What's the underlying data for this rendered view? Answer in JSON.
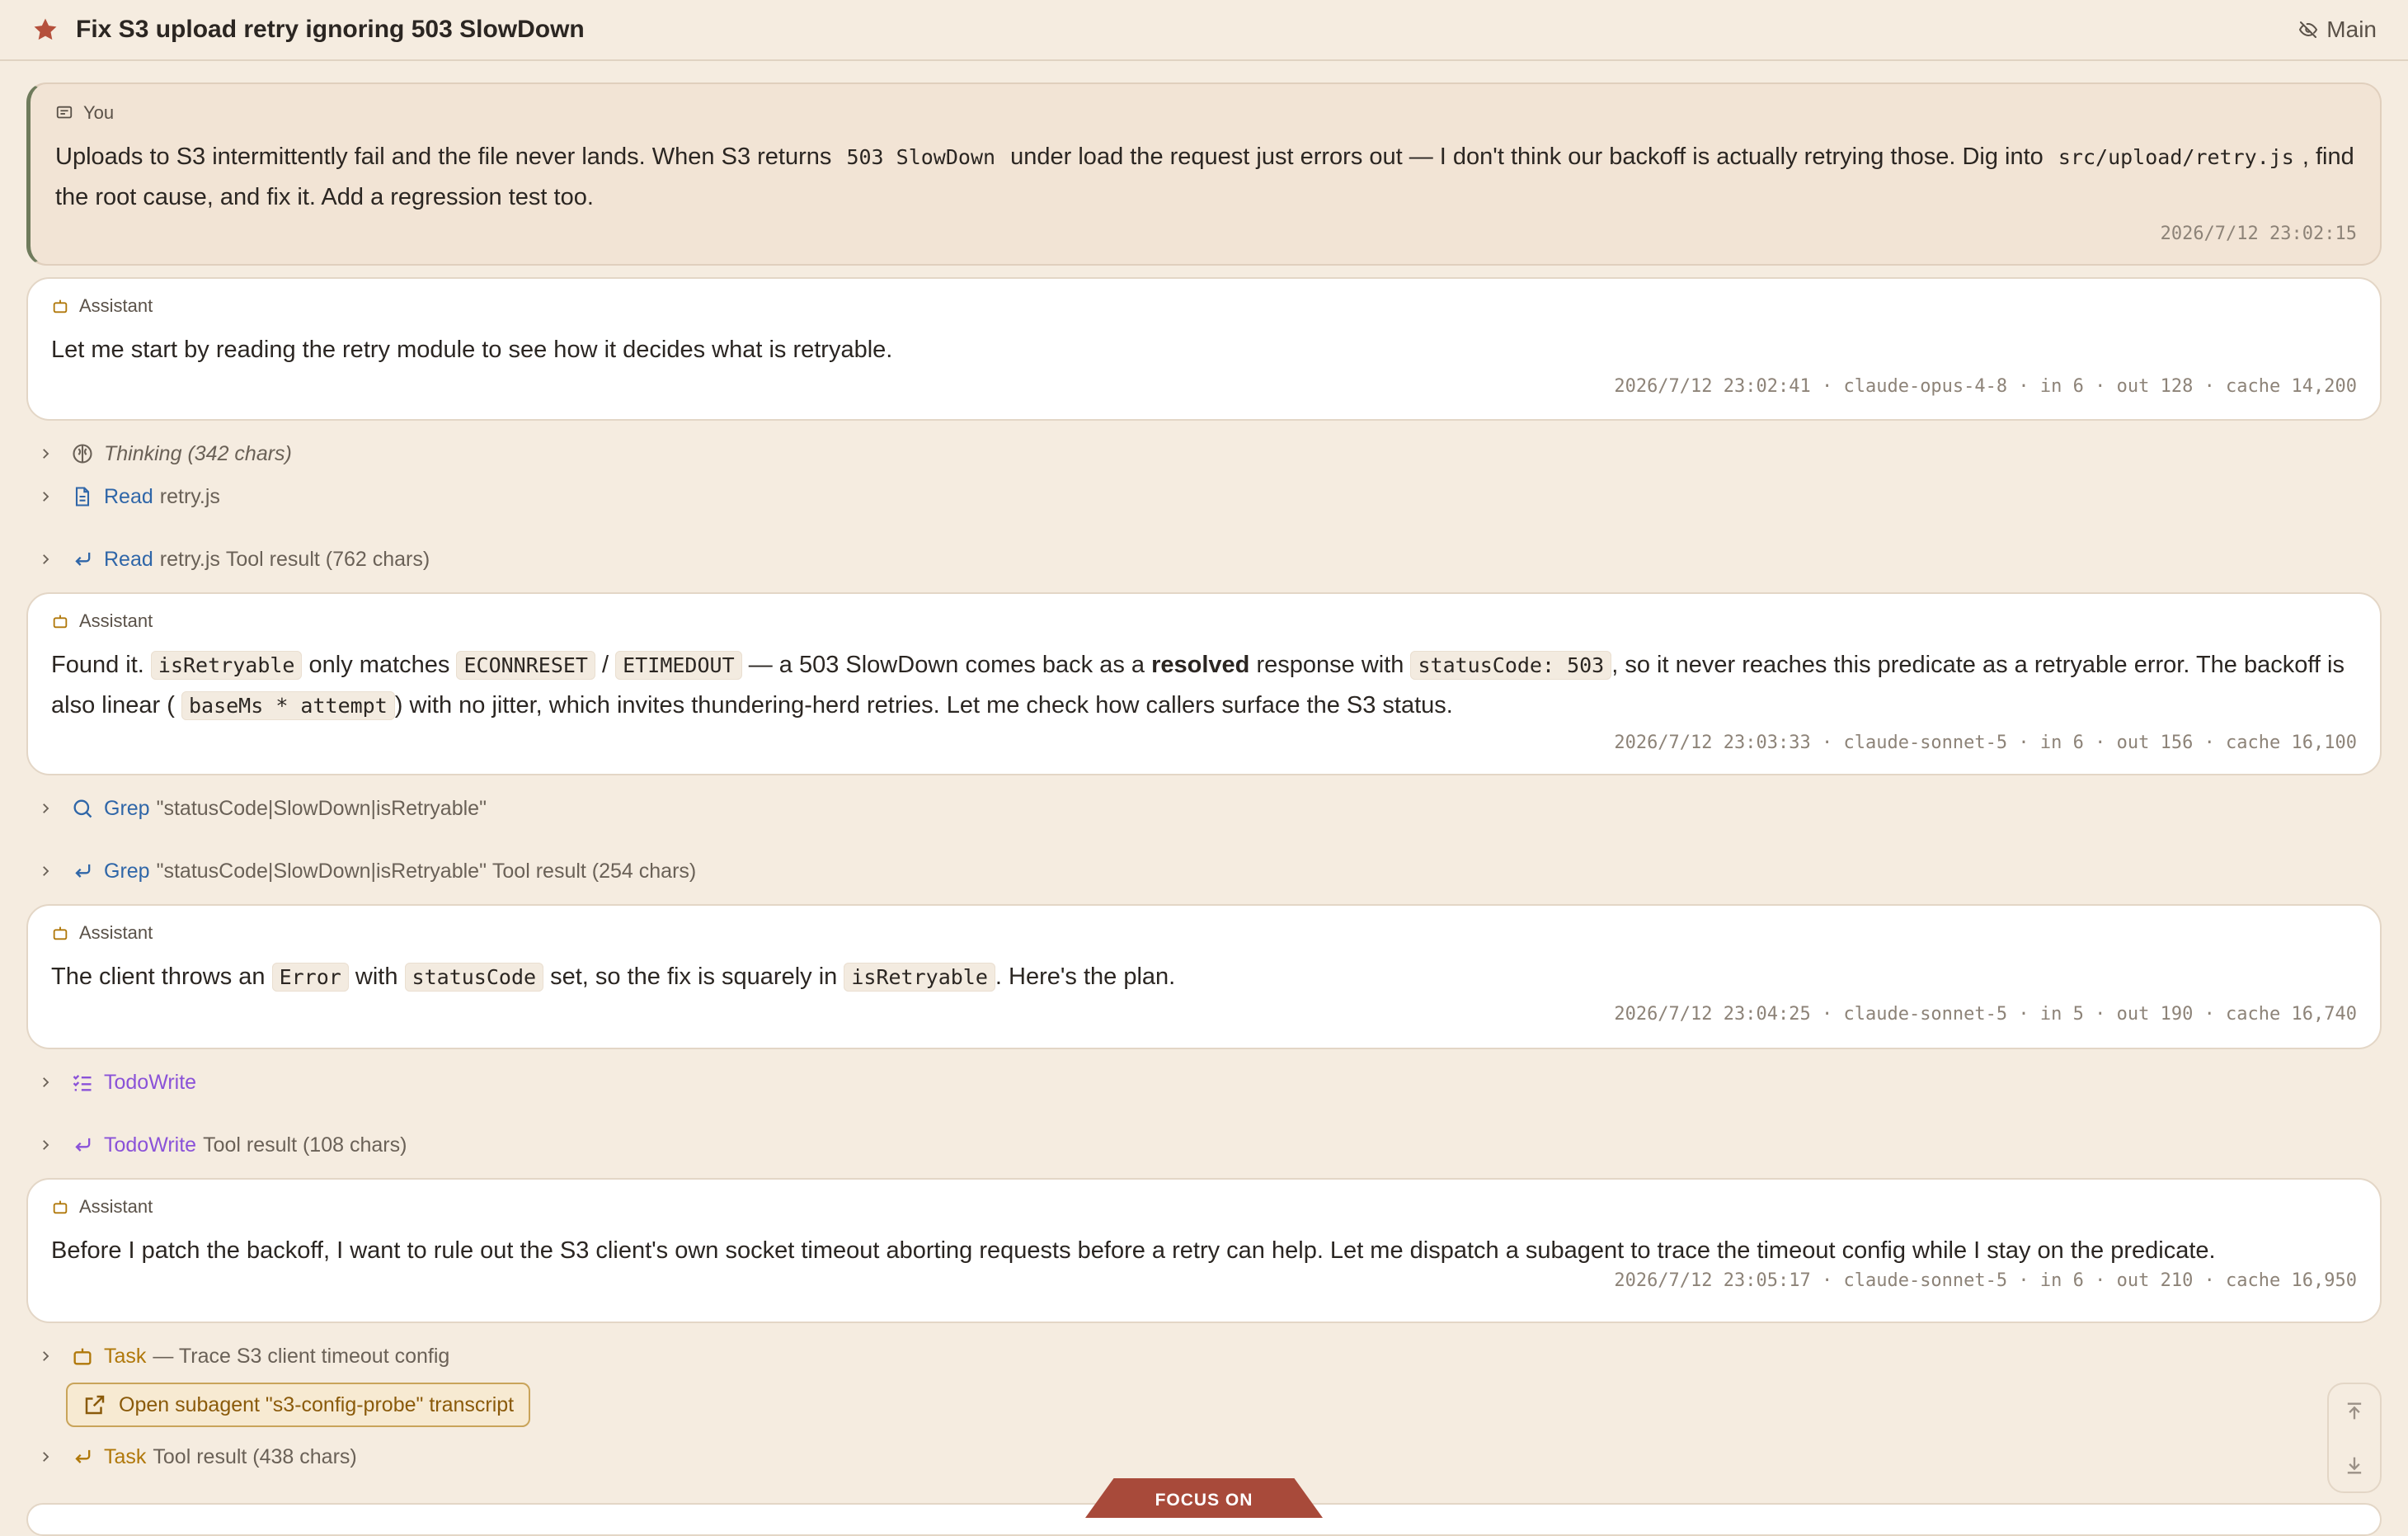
{
  "header": {
    "title": "Fix S3 upload retry ignoring 503 SlowDown",
    "toggle_label": "Main"
  },
  "user_message": {
    "role": "You",
    "p1": "Uploads to S3 intermittently fail and the file never lands. When S3 returns",
    "c1": "503 SlowDown",
    "p2": "under load the request just errors out — I don't think our backoff is actually retrying those. Dig into",
    "c2": "src/upload/retry.js",
    "p3": ", find the root cause, and fix it. Add a regression test too.",
    "meta": "2026/7/12 23:02:15"
  },
  "assistant_1": {
    "role": "Assistant",
    "text": "Let me start by reading the retry module to see how it decides what is retryable.",
    "meta": "2026/7/12 23:02:41 · claude-opus-4-8 · in 6 · out 128 · cache 14,200"
  },
  "thinking": {
    "label": "Thinking (342 chars)"
  },
  "read_call": {
    "tool": "Read",
    "arg": "retry.js"
  },
  "read_result": {
    "tool": "Read",
    "arg": "retry.js",
    "suffix": "Tool result (762 chars)"
  },
  "assistant_2": {
    "role": "Assistant",
    "t1": "Found it.",
    "c1": "isRetryable",
    "t2": "only matches",
    "c2": "ECONNRESET",
    "t3": "/",
    "c3": "ETIMEDOUT",
    "t4": "— a 503 SlowDown comes back as a",
    "b1": "resolved",
    "t5": "response with",
    "c4": "statusCode: 503",
    "t6": ", so it never reaches this predicate as a retryable error. The backoff is also linear (",
    "c5": "baseMs * attempt",
    "t7": ") with no jitter, which invites thundering-herd retries. Let me check how callers surface the S3 status.",
    "meta": "2026/7/12 23:03:33 · claude-sonnet-5 · in 6 · out 156 · cache 16,100"
  },
  "grep_call": {
    "tool": "Grep",
    "arg": "\"statusCode|SlowDown|isRetryable\""
  },
  "grep_result": {
    "tool": "Grep",
    "arg": "\"statusCode|SlowDown|isRetryable\"",
    "suffix": "Tool result (254 chars)"
  },
  "assistant_3": {
    "role": "Assistant",
    "t1": "The client throws an",
    "c1": "Error",
    "t2": "with",
    "c2": "statusCode",
    "t3": "set, so the fix is squarely in",
    "c3": "isRetryable",
    "t4": ". Here's the plan.",
    "meta": "2026/7/12 23:04:25 · claude-sonnet-5 · in 5 · out 190 · cache 16,740"
  },
  "todo_call": {
    "tool": "TodoWrite"
  },
  "todo_result": {
    "tool": "TodoWrite",
    "suffix": "Tool result (108 chars)"
  },
  "assistant_4": {
    "role": "Assistant",
    "text": "Before I patch the backoff, I want to rule out the S3 client's own socket timeout aborting requests before a retry can help. Let me dispatch a subagent to trace the timeout config while I stay on the predicate.",
    "meta": "2026/7/12 23:05:17 · claude-sonnet-5 · in 6 · out 210 · cache 16,950"
  },
  "task_call": {
    "tool": "Task",
    "arg": "— Trace S3 client timeout config"
  },
  "subagent_button": {
    "label": "Open subagent \"s3-config-probe\" transcript"
  },
  "task_result": {
    "tool": "Task",
    "suffix": "Tool result (438 chars)"
  },
  "focus_tab": {
    "label": "FOCUS ON"
  },
  "colors": {
    "background": "#f5ece0",
    "accent": "#a84a3a",
    "read_tool": "#2f66a8",
    "todo_tool": "#8a52d8",
    "task_tool": "#b0780a"
  }
}
